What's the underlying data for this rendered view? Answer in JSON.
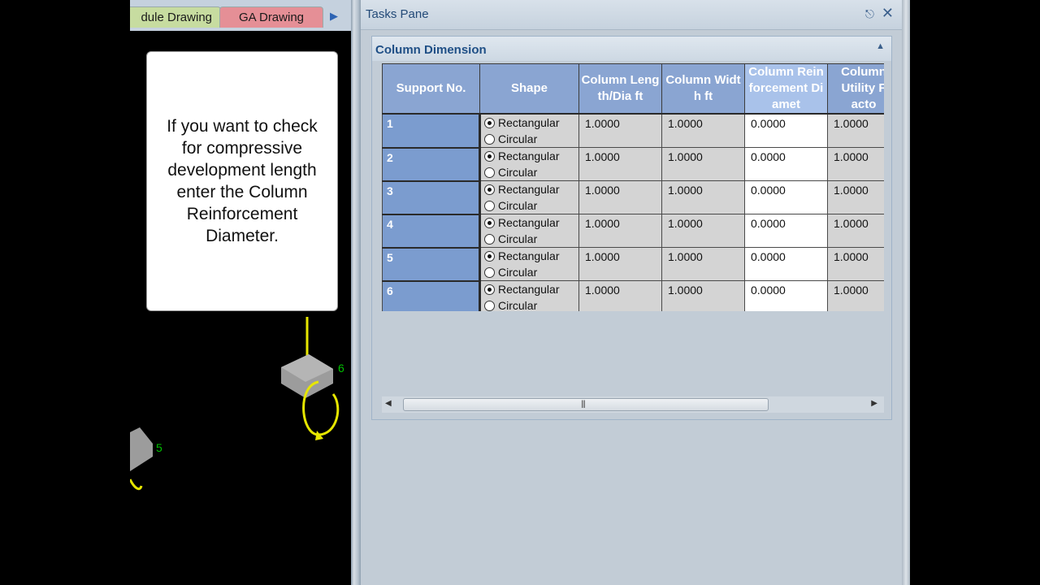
{
  "document_tabs": [
    {
      "label": "dule Drawing",
      "color": "#c7dca0"
    },
    {
      "label": "GA Drawing",
      "color": "#e58f96"
    }
  ],
  "callout": {
    "text": "If you want to check for compressive development length enter the Column Reinforcement Diameter."
  },
  "drawing": {
    "labels": [
      "6",
      "5"
    ],
    "colors": {
      "node": "#00c000",
      "member": "#e6e600",
      "support": "#9c9c9c"
    }
  },
  "tasks_pane": {
    "title": "Tasks Pane",
    "icons": [
      "pin-icon",
      "close-icon"
    ],
    "group": {
      "title": "Column Dimension",
      "columns": [
        "Support No.",
        "Shape",
        "Column Length/Dia ft",
        "Column Width ft",
        "Column Reinforcement Diamet",
        "Column Utility Facto"
      ],
      "shape_options": [
        "Rectangular",
        "Circular"
      ],
      "rows": [
        {
          "support_no": "1",
          "shape": "Rectangular",
          "length": "1.0000",
          "width": "1.0000",
          "reinforcement": "0.0000",
          "utility": "1.0000"
        },
        {
          "support_no": "2",
          "shape": "Rectangular",
          "length": "1.0000",
          "width": "1.0000",
          "reinforcement": "0.0000",
          "utility": "1.0000"
        },
        {
          "support_no": "3",
          "shape": "Rectangular",
          "length": "1.0000",
          "width": "1.0000",
          "reinforcement": "0.0000",
          "utility": "1.0000"
        },
        {
          "support_no": "4",
          "shape": "Rectangular",
          "length": "1.0000",
          "width": "1.0000",
          "reinforcement": "0.0000",
          "utility": "1.0000"
        },
        {
          "support_no": "5",
          "shape": "Rectangular",
          "length": "1.0000",
          "width": "1.0000",
          "reinforcement": "0.0000",
          "utility": "1.0000"
        },
        {
          "support_no": "6",
          "shape": "Rectangular",
          "length": "1.0000",
          "width": "1.0000",
          "reinforcement": "0.0000",
          "utility": "1.0000"
        }
      ]
    }
  },
  "colors": {
    "header_bg": "#8aa5d2",
    "active_header_bg": "#a9c2ea",
    "row_header_bg": "#7b9ccf",
    "title_text": "#1f4f86"
  }
}
